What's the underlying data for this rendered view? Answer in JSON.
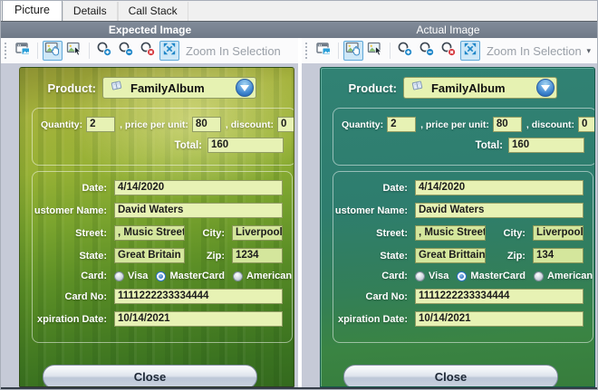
{
  "tabs": {
    "picture": "Picture",
    "details": "Details",
    "call_stack": "Call Stack"
  },
  "toolbar": {
    "zoom_selection_label": "Zoom In Selection"
  },
  "colors": {
    "header_bg": "#76808e",
    "panel_bg": "#c6cad7",
    "input_bg": "#e7f2b4",
    "accent_blue": "#1f86c8",
    "active_button_bg": "#cde7f7",
    "expected_form_top": "#9aae36",
    "expected_form_bottom": "#346a1e",
    "actual_form_top": "#2e7d6e",
    "actual_form_bottom": "#3a8443"
  },
  "icons": [
    "float-window-icon",
    "pan-mode-icon",
    "select-mode-icon",
    "zoom-in-icon",
    "zoom-out-icon",
    "zoom-reset-icon",
    "zoom-fit-icon",
    "dropdown-arrow-icon",
    "product-book-icon",
    "toolbar-overflow-icon"
  ],
  "expected": {
    "title": "Expected Image",
    "form": {
      "product_label": "Product:",
      "product_value": "FamilyAlbum",
      "quantity_label": "Quantity:",
      "quantity": "2",
      "price_label": ", price per unit:",
      "price": "80",
      "discount_label": ", discount:",
      "discount": "0",
      "total_label": "Total:",
      "total": "160",
      "date_label": "Date:",
      "date": "4/14/2020",
      "customer_label": "ustomer Name:",
      "customer": "David Waters",
      "street_label": "Street:",
      "street": ", Music Street",
      "city_label": "City:",
      "city": "Liverpool",
      "state_label": "State:",
      "state": "Great Britain",
      "zip_label": "Zip:",
      "zip": "1234",
      "card_label": "Card:",
      "visa": "Visa",
      "mastercard": "MasterCard",
      "amex": "American Expre",
      "card_selected": "MasterCard",
      "card_no_label": "Card No:",
      "card_no": "1111222233334444",
      "expiration_label": "xpiration Date:",
      "expiration": "10/14/2021",
      "close_label": "Close"
    }
  },
  "actual": {
    "title": "Actual Image",
    "form": {
      "product_label": "Product:",
      "product_value": "FamilyAlbum",
      "quantity_label": "Quantity:",
      "quantity": "2",
      "price_label": ", price per unit:",
      "price": "80",
      "discount_label": ", discount:",
      "discount": "0",
      "total_label": "Total:",
      "total": "160",
      "date_label": "Date:",
      "date": "4/14/2020",
      "customer_label": "ustomer Name:",
      "customer": "David Waters",
      "street_label": "Street:",
      "street": ", Music Street",
      "city_label": "City:",
      "city": "Liverpool",
      "state_label": "State:",
      "state": "Great Brittain",
      "zip_label": "Zip:",
      "zip": "134",
      "card_label": "Card:",
      "visa": "Visa",
      "mastercard": "MasterCard",
      "amex": "American Expre",
      "card_selected": "MasterCard",
      "card_no_label": "Card No:",
      "card_no": "1111222233334444",
      "expiration_label": "xpiration Date:",
      "expiration": "10/14/2021",
      "close_label": "Close"
    }
  }
}
